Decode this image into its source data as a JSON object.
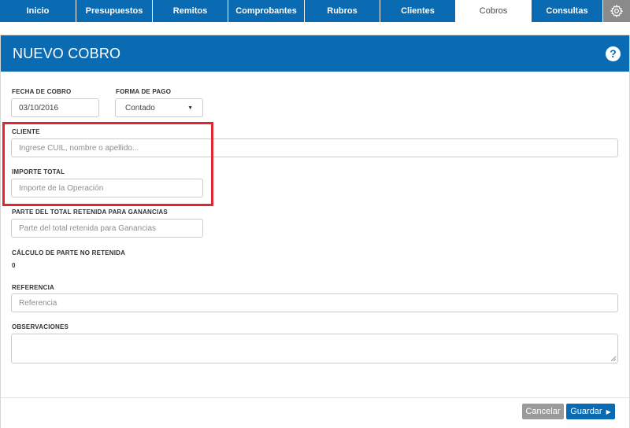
{
  "nav": {
    "tabs": [
      {
        "label": "Inicio",
        "active": false
      },
      {
        "label": "Presupuestos",
        "active": false
      },
      {
        "label": "Remitos",
        "active": false
      },
      {
        "label": "Comprobantes",
        "active": false
      },
      {
        "label": "Rubros",
        "active": false
      },
      {
        "label": "Clientes",
        "active": false
      },
      {
        "label": "Cobros",
        "active": true
      },
      {
        "label": "Consultas",
        "active": false
      }
    ],
    "settings_icon": "gear-icon"
  },
  "panel": {
    "title": "NUEVO COBRO",
    "help_icon": "?"
  },
  "form": {
    "fecha_label": "FECHA DE COBRO",
    "fecha_value": "03/10/2016",
    "forma_label": "FORMA DE PAGO",
    "forma_value": "Contado",
    "cliente_label": "CLIENTE",
    "cliente_placeholder": "Ingrese CUIL, nombre o apellido...",
    "importe_label": "IMPORTE TOTAL",
    "importe_placeholder": "Importe de la Operación",
    "retenida_label": "PARTE DEL TOTAL RETENIDA PARA GANANCIAS",
    "retenida_placeholder": "Parte del total retenida para Ganancias",
    "calculo_label": "CÁLCULO DE PARTE NO RETENIDA",
    "calculo_value": "0",
    "referencia_label": "REFERENCIA",
    "referencia_placeholder": "Referencia",
    "observaciones_label": "OBSERVACIONES"
  },
  "buttons": {
    "cancel": "Cancelar",
    "save": "Guardar"
  },
  "colors": {
    "primary": "#0a6ab2",
    "highlight": "#e0262e",
    "cancel": "#9a9a9a",
    "gear_bg": "#8a8a8a"
  }
}
